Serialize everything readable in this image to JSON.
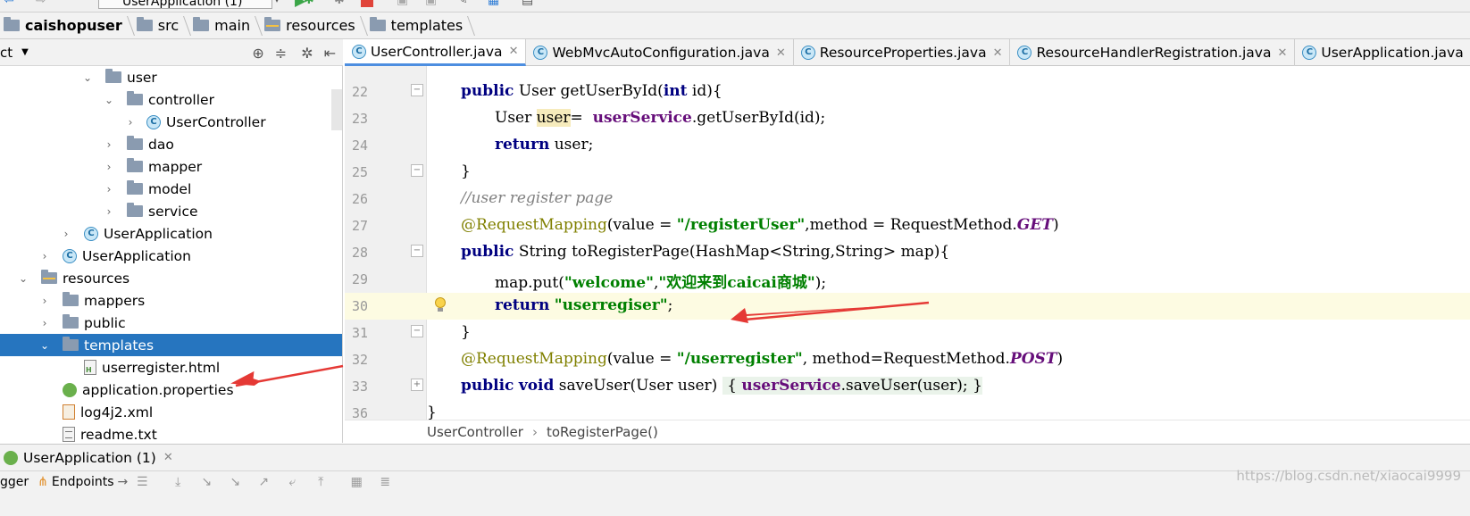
{
  "toolbar": {
    "run_config": "UserApplication (1)"
  },
  "breadcrumb": [
    {
      "label": "caishopuser",
      "bold": true
    },
    {
      "label": "src"
    },
    {
      "label": "main"
    },
    {
      "label": "resources"
    },
    {
      "label": "templates"
    }
  ],
  "project_panel": {
    "title": "ct",
    "tree": [
      {
        "label": "user",
        "icon": "folder-icon",
        "arrow": "down"
      },
      {
        "label": "controller",
        "icon": "folder-icon",
        "arrow": "down"
      },
      {
        "label": "UserController",
        "icon": "class-icon",
        "arrow": "right"
      },
      {
        "label": "dao",
        "icon": "folder-icon",
        "arrow": "right"
      },
      {
        "label": "mapper",
        "icon": "folder-icon",
        "arrow": "right"
      },
      {
        "label": "model",
        "icon": "folder-icon",
        "arrow": "right"
      },
      {
        "label": "service",
        "icon": "folder-icon",
        "arrow": "right"
      },
      {
        "label": "UserApplication",
        "icon": "spring-class-icon",
        "arrow": "right"
      },
      {
        "label": "UserApplication",
        "icon": "spring-class-icon",
        "arrow": "right"
      },
      {
        "label": "resources",
        "icon": "resources-folder-icon",
        "arrow": "down"
      },
      {
        "label": "mappers",
        "icon": "folder-icon",
        "arrow": "right"
      },
      {
        "label": "public",
        "icon": "folder-icon",
        "arrow": "right"
      },
      {
        "label": "templates",
        "icon": "folder-icon",
        "arrow": "down",
        "selected": true
      },
      {
        "label": "userregister.html",
        "icon": "html-file-icon"
      },
      {
        "label": "application.properties",
        "icon": "spring-leaf-icon"
      },
      {
        "label": "log4j2.xml",
        "icon": "xml-file-icon"
      },
      {
        "label": "readme.txt",
        "icon": "text-file-icon"
      }
    ]
  },
  "editor_tabs": [
    {
      "label": "UserController.java",
      "active": true
    },
    {
      "label": "WebMvcAutoConfiguration.java"
    },
    {
      "label": "ResourceProperties.java"
    },
    {
      "label": "ResourceHandlerRegistration.java"
    },
    {
      "label": "UserApplication.java"
    }
  ],
  "code": {
    "lines": [
      {
        "num": "22",
        "kind": "getUser"
      },
      {
        "num": "23",
        "kind": "userAssign"
      },
      {
        "num": "24",
        "kind": "returnUser"
      },
      {
        "num": "25",
        "kind": "closeBrace"
      },
      {
        "num": "26",
        "kind": "comment"
      },
      {
        "num": "27",
        "kind": "mappingGet"
      },
      {
        "num": "28",
        "kind": "toRegister"
      },
      {
        "num": "29",
        "kind": "mapPut"
      },
      {
        "num": "30",
        "kind": "returnStr",
        "highlight": true
      },
      {
        "num": "31",
        "kind": "closeBrace"
      },
      {
        "num": "32",
        "kind": "mappingPost"
      },
      {
        "num": "33",
        "kind": "saveUser"
      },
      {
        "num": "36",
        "kind": "classClose"
      }
    ],
    "tokens": {
      "public": "public",
      "User": "User",
      "getUserById_sig": "getUserById(",
      "int": "int",
      "id_close": "id){",
      "user_var": "user",
      "assign": "=  ",
      "userService": "userService",
      "getUserById_call": ".getUserById(id);",
      "return": "return",
      "user_semi": "user;",
      "close": "}",
      "comment": "//user register page",
      "RequestMapping": "@RequestMapping",
      "value_eq": "(value = ",
      "registerUser_str": "\"/registerUser\"",
      "method_get": ",method = RequestMethod.",
      "GET": "GET",
      "paren_close": ")",
      "String": "String",
      "toRegister_sig": "toRegisterPage(HashMap<String,String> map){",
      "mapput": "map.put(",
      "welcome_str": "\"welcome\"",
      "comma": ",",
      "welcome_msg": "\"欢迎来到caicai商城\"",
      "end_stmt": ");",
      "userregiser_str": "\"userregiser\"",
      "semi": ";",
      "userregister_str": "\"/userregister\"",
      "method_post": ", method=RequestMethod.",
      "POST": "POST",
      "void": "void",
      "saveUser_sig": "saveUser(User user)",
      "open_brace": "{",
      "saveUser_call": ".saveUser(user);",
      "close_brace": "}"
    }
  },
  "code_crumbs": {
    "class": "UserController",
    "method": "toRegisterPage()"
  },
  "run_panel": {
    "tab": "UserApplication (1)",
    "debugger_tab": "gger",
    "endpoints_tab": "Endpoints"
  },
  "watermark": "https://blog.csdn.net/xiaocai9999",
  "colors": {
    "selection": "#2675bf",
    "current_line": "#fdfbe2",
    "keyword": "#000080",
    "string": "#008000",
    "annotation": "#808000",
    "arrow": "#e53935"
  }
}
